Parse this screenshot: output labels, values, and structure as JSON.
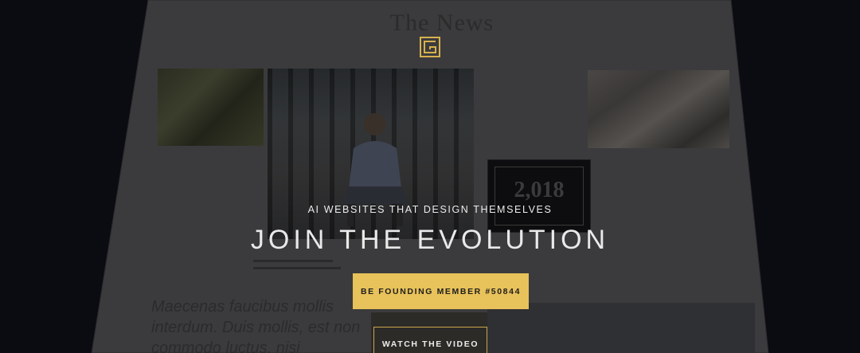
{
  "background_page": {
    "title": "The News",
    "logo_icon": "g-maze-logo-icon",
    "stat_card_number": "2,018",
    "article_excerpt": "Maecenas faucibus mollis interdum. Duis mollis, est non commodo luctus, nisi"
  },
  "hero": {
    "eyebrow": "AI WEBSITES THAT DESIGN THEMSELVES",
    "title": "JOIN THE EVOLUTION",
    "cta_label": "BE FOUNDING MEMBER #50844",
    "video_label": "WATCH THE VIDEO"
  },
  "colors": {
    "accent": "#e8c25a",
    "background": "#0b0b12",
    "page_overlay": "#3a3a3c"
  }
}
